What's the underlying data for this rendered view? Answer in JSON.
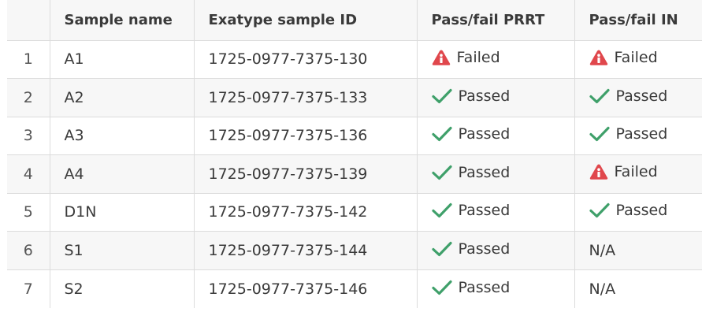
{
  "table": {
    "headers": [
      "",
      "Sample name",
      "Exatype sample ID",
      "Pass/fail PRRT",
      "Pass/fail IN"
    ],
    "rows": [
      {
        "index": "1",
        "name": "A1",
        "id": "1725-0977-7375-130",
        "prrt": {
          "status": "failed",
          "label": "Failed"
        },
        "in": {
          "status": "failed",
          "label": "Failed"
        }
      },
      {
        "index": "2",
        "name": "A2",
        "id": "1725-0977-7375-133",
        "prrt": {
          "status": "passed",
          "label": "Passed"
        },
        "in": {
          "status": "passed",
          "label": "Passed"
        }
      },
      {
        "index": "3",
        "name": "A3",
        "id": "1725-0977-7375-136",
        "prrt": {
          "status": "passed",
          "label": "Passed"
        },
        "in": {
          "status": "passed",
          "label": "Passed"
        }
      },
      {
        "index": "4",
        "name": "A4",
        "id": "1725-0977-7375-139",
        "prrt": {
          "status": "passed",
          "label": "Passed"
        },
        "in": {
          "status": "failed",
          "label": "Failed"
        }
      },
      {
        "index": "5",
        "name": "D1N",
        "id": "1725-0977-7375-142",
        "prrt": {
          "status": "passed",
          "label": "Passed"
        },
        "in": {
          "status": "passed",
          "label": "Passed"
        }
      },
      {
        "index": "6",
        "name": "S1",
        "id": "1725-0977-7375-144",
        "prrt": {
          "status": "passed",
          "label": "Passed"
        },
        "in": {
          "status": "na",
          "label": "N/A"
        }
      },
      {
        "index": "7",
        "name": "S2",
        "id": "1725-0977-7375-146",
        "prrt": {
          "status": "passed",
          "label": "Passed"
        },
        "in": {
          "status": "na",
          "label": "N/A"
        }
      }
    ]
  },
  "icons": {
    "passed": "checkmark-icon",
    "failed": "warning-icon"
  },
  "colors": {
    "passed": "#3fa06a",
    "failed": "#e0474c",
    "text": "#3a3a3a",
    "grid": "#dcdcdc",
    "stripe": "#f7f7f7"
  }
}
